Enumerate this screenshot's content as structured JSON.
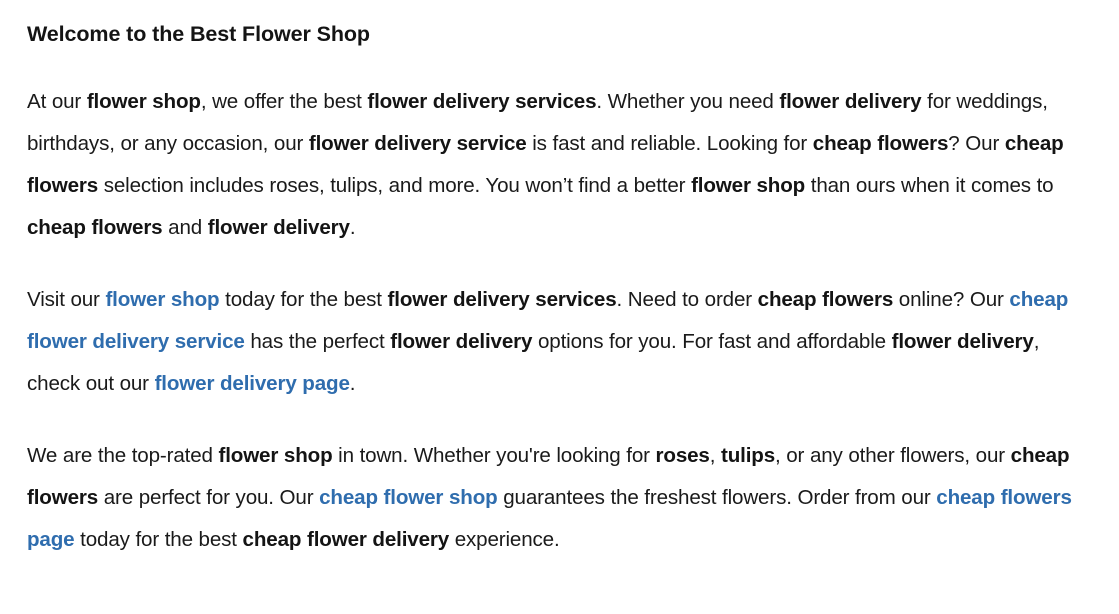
{
  "page": {
    "background_color": "#ffffff",
    "text_color": "#1a1a1a",
    "link_color": "#2f6dae",
    "heading_color": "#141414"
  },
  "heading": {
    "text": "Welcome to the Best Flower Shop"
  },
  "paragraphs": [
    {
      "id": "paragraph-1",
      "segments": [
        {
          "type": "plain",
          "text": "At our "
        },
        {
          "type": "strong",
          "text": "flower shop"
        },
        {
          "type": "plain",
          "text": ", we offer the best "
        },
        {
          "type": "strong",
          "text": "flower delivery services"
        },
        {
          "type": "plain",
          "text": ". Whether you need "
        },
        {
          "type": "strong",
          "text": "flower delivery"
        },
        {
          "type": "plain",
          "text": " for weddings, birthdays, or any occasion, our "
        },
        {
          "type": "strong",
          "text": "flower delivery service"
        },
        {
          "type": "plain",
          "text": " is fast and reliable. Looking for "
        },
        {
          "type": "strong",
          "text": "cheap flowers"
        },
        {
          "type": "plain",
          "text": "? Our "
        },
        {
          "type": "strong",
          "text": "cheap flowers"
        },
        {
          "type": "plain",
          "text": " selection includes roses, tulips, and more. You won’t find a better "
        },
        {
          "type": "strong",
          "text": "flower shop"
        },
        {
          "type": "plain",
          "text": " than ours when it comes to "
        },
        {
          "type": "strong",
          "text": "cheap flowers"
        },
        {
          "type": "plain",
          "text": " and "
        },
        {
          "type": "strong",
          "text": "flower delivery"
        },
        {
          "type": "plain",
          "text": "."
        }
      ]
    },
    {
      "id": "paragraph-2",
      "segments": [
        {
          "type": "plain",
          "text": "Visit our "
        },
        {
          "type": "link",
          "text": "flower shop"
        },
        {
          "type": "plain",
          "text": " today for the best "
        },
        {
          "type": "strong",
          "text": "flower delivery services"
        },
        {
          "type": "plain",
          "text": ". Need to order "
        },
        {
          "type": "strong",
          "text": "cheap flowers"
        },
        {
          "type": "plain",
          "text": " online? Our "
        },
        {
          "type": "link",
          "text": "cheap flower delivery service"
        },
        {
          "type": "plain",
          "text": " has the perfect "
        },
        {
          "type": "strong",
          "text": "flower delivery"
        },
        {
          "type": "plain",
          "text": " options for you. For fast and affordable "
        },
        {
          "type": "strong",
          "text": "flower delivery"
        },
        {
          "type": "plain",
          "text": ", check out our "
        },
        {
          "type": "link",
          "text": "flower delivery page"
        },
        {
          "type": "plain",
          "text": "."
        }
      ]
    },
    {
      "id": "paragraph-3",
      "segments": [
        {
          "type": "plain",
          "text": "We are the top-rated "
        },
        {
          "type": "strong",
          "text": "flower shop"
        },
        {
          "type": "plain",
          "text": " in town. Whether you're looking for "
        },
        {
          "type": "strong",
          "text": "roses"
        },
        {
          "type": "plain",
          "text": ", "
        },
        {
          "type": "strong",
          "text": "tulips"
        },
        {
          "type": "plain",
          "text": ", or any other flowers, our "
        },
        {
          "type": "strong",
          "text": "cheap flowers"
        },
        {
          "type": "plain",
          "text": " are perfect for you. Our "
        },
        {
          "type": "link",
          "text": "cheap flower shop"
        },
        {
          "type": "plain",
          "text": " guarantees the freshest flowers. Order from our "
        },
        {
          "type": "link",
          "text": "cheap flowers page"
        },
        {
          "type": "plain",
          "text": " today for the best "
        },
        {
          "type": "strong",
          "text": "cheap flower delivery"
        },
        {
          "type": "plain",
          "text": " experience."
        }
      ]
    }
  ]
}
